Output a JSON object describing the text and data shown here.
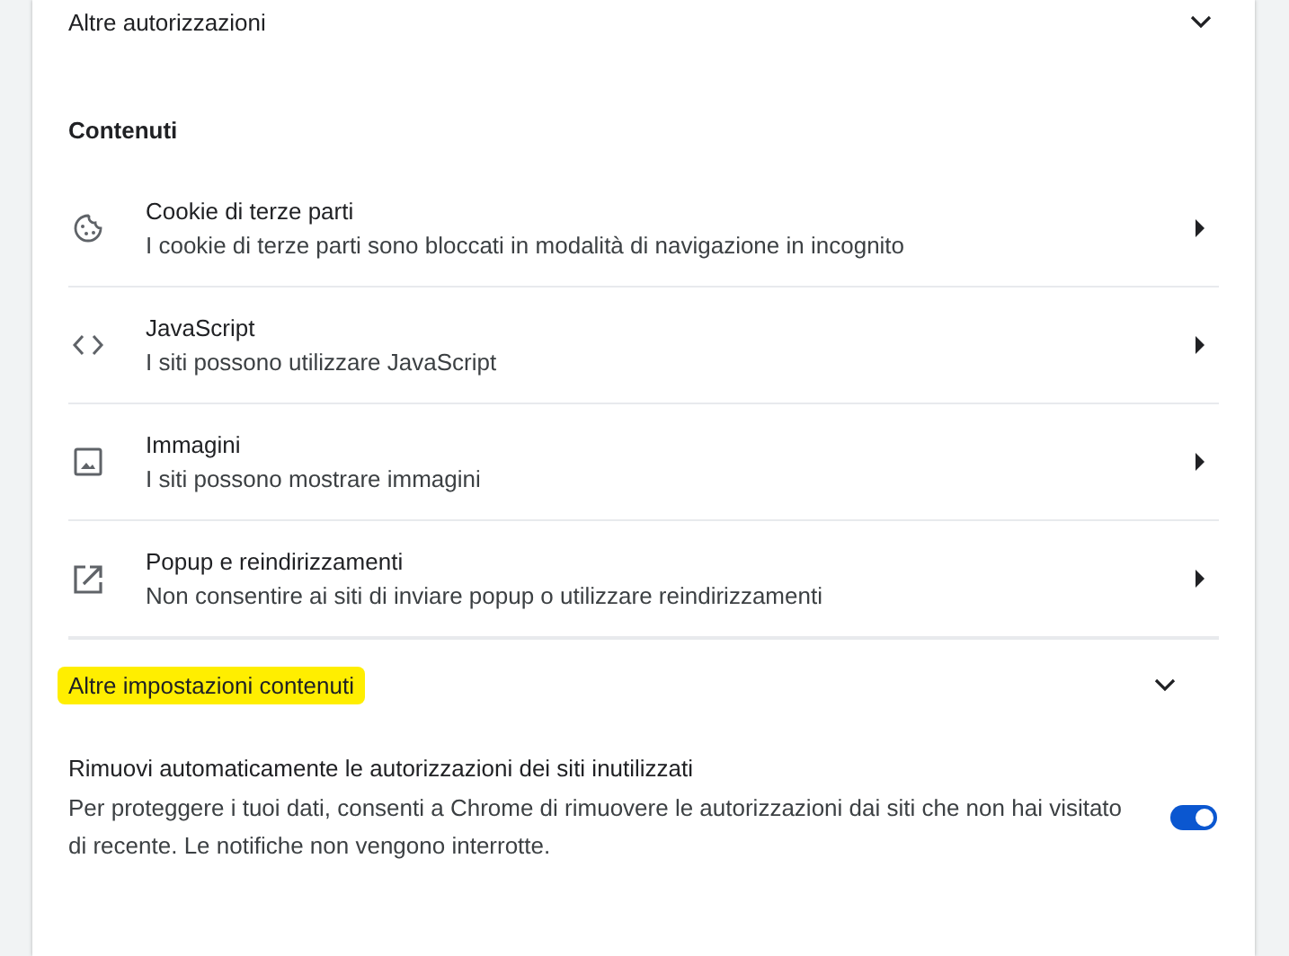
{
  "top_expander": {
    "label": "Altre autorizzazioni",
    "expanded": false
  },
  "section": {
    "heading": "Contenuti",
    "items": [
      {
        "title": "Cookie di terze parti",
        "subtitle": "I cookie di terze parti sono bloccati in modalità di navigazione in incognito"
      },
      {
        "title": "JavaScript",
        "subtitle": "I siti possono utilizzare JavaScript"
      },
      {
        "title": "Immagini",
        "subtitle": "I siti possono mostrare immagini"
      },
      {
        "title": "Popup e reindirizzamenti",
        "subtitle": "Non consentire ai siti di inviare popup o utilizzare reindirizzamenti"
      }
    ]
  },
  "more_expander": {
    "label": "Altre impostazioni contenuti",
    "expanded": false,
    "highlighted": true
  },
  "auto_remove": {
    "title": "Rimuovi automaticamente le autorizzazioni dei siti inutilizzati",
    "description": "Per proteggere i tuoi dati, consenti a Chrome di rimuovere le autorizzazioni dai siti che non hai visitato di recente. Le notifiche non vengono interrotte.",
    "on": true
  }
}
